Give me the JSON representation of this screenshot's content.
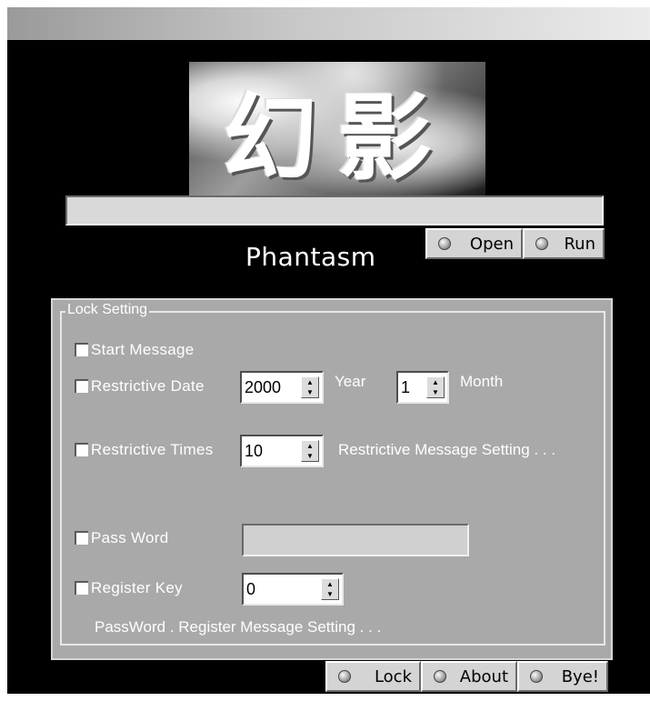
{
  "app": {
    "name": "Phantasm",
    "logo_text": "幻影",
    "path_value": ""
  },
  "top_buttons": [
    {
      "label": "Open",
      "icon": "disc-icon"
    },
    {
      "label": "Run",
      "icon": "disc-icon"
    }
  ],
  "lock_setting": {
    "title": "Lock Setting",
    "start_message": {
      "label": "Start  Message",
      "checked": false
    },
    "restrictive_date": {
      "label": "Restrictive  Date",
      "checked": false,
      "year_value": "2000",
      "year_unit": "Year",
      "month_value": "1",
      "month_unit": "Month"
    },
    "restrictive_times": {
      "label": "Restrictive  Times",
      "checked": false,
      "value": "10",
      "message_link": "Restrictive  Message Setting  . . ."
    },
    "pass_word": {
      "label": "Pass  Word",
      "checked": false,
      "value": ""
    },
    "register_key": {
      "label": "Register  Key",
      "checked": false,
      "value": "0"
    },
    "pw_message_link": "PassWord . Register  Message Setting  . . ."
  },
  "bottom_buttons": [
    {
      "label": "Lock",
      "icon": "disc-icon"
    },
    {
      "label": "About",
      "icon": "disc-icon"
    },
    {
      "label": "Bye!",
      "icon": "disc-icon"
    }
  ]
}
